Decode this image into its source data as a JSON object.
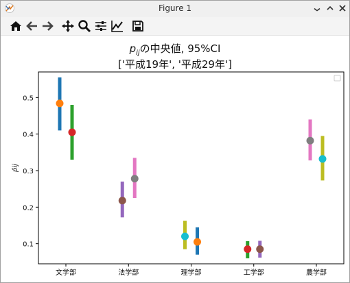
{
  "window": {
    "title": "Figure 1"
  },
  "toolbar": {
    "buttons": [
      {
        "name": "home",
        "icon": "home-icon"
      },
      {
        "name": "back",
        "icon": "arrow-left-icon"
      },
      {
        "name": "forward",
        "icon": "arrow-right-icon"
      },
      {
        "name": "pan",
        "icon": "move-icon"
      },
      {
        "name": "zoom",
        "icon": "zoom-icon"
      },
      {
        "name": "subplots",
        "icon": "sliders-icon"
      },
      {
        "name": "edit-axis",
        "icon": "line-chart-icon"
      },
      {
        "name": "save",
        "icon": "save-icon"
      }
    ]
  },
  "chart_data": {
    "type": "scatter",
    "title": {
      "symbol": "p",
      "subscript": "ij",
      "suffix": "の中央値, 95%CI",
      "line2": "['平成19年', '平成29年']"
    },
    "ylabel": "p̂ij",
    "xlabel": "",
    "ylim": [
      0.045,
      0.57
    ],
    "yticks": [
      0.1,
      0.2,
      0.3,
      0.4,
      0.5
    ],
    "categories": [
      "文学部",
      "法学部",
      "理学部",
      "工学部",
      "農学部"
    ],
    "legend": "top-right",
    "grid": false,
    "series": [
      {
        "category": "文学部",
        "offset": "left",
        "median": 0.484,
        "low": 0.41,
        "high": 0.555,
        "bar_color": "#1f77b4",
        "dot_color": "#ff7f0e"
      },
      {
        "category": "文学部",
        "offset": "right",
        "median": 0.405,
        "low": 0.33,
        "high": 0.48,
        "bar_color": "#2ca02c",
        "dot_color": "#d62728"
      },
      {
        "category": "法学部",
        "offset": "left",
        "median": 0.218,
        "low": 0.172,
        "high": 0.27,
        "bar_color": "#9467bd",
        "dot_color": "#8c564b"
      },
      {
        "category": "法学部",
        "offset": "right",
        "median": 0.278,
        "low": 0.225,
        "high": 0.335,
        "bar_color": "#e377c2",
        "dot_color": "#7f7f7f"
      },
      {
        "category": "理学部",
        "offset": "left",
        "median": 0.12,
        "low": 0.085,
        "high": 0.163,
        "bar_color": "#bcbd22",
        "dot_color": "#17becf"
      },
      {
        "category": "理学部",
        "offset": "right",
        "median": 0.105,
        "low": 0.07,
        "high": 0.145,
        "bar_color": "#1f77b4",
        "dot_color": "#ff7f0e"
      },
      {
        "category": "工学部",
        "offset": "left",
        "median": 0.085,
        "low": 0.06,
        "high": 0.107,
        "bar_color": "#2ca02c",
        "dot_color": "#d62728"
      },
      {
        "category": "工学部",
        "offset": "right",
        "median": 0.085,
        "low": 0.062,
        "high": 0.108,
        "bar_color": "#9467bd",
        "dot_color": "#8c564b"
      },
      {
        "category": "農学部",
        "offset": "left",
        "median": 0.382,
        "low": 0.328,
        "high": 0.44,
        "bar_color": "#e377c2",
        "dot_color": "#7f7f7f"
      },
      {
        "category": "農学部",
        "offset": "right",
        "median": 0.332,
        "low": 0.273,
        "high": 0.395,
        "bar_color": "#bcbd22",
        "dot_color": "#17becf"
      }
    ]
  }
}
